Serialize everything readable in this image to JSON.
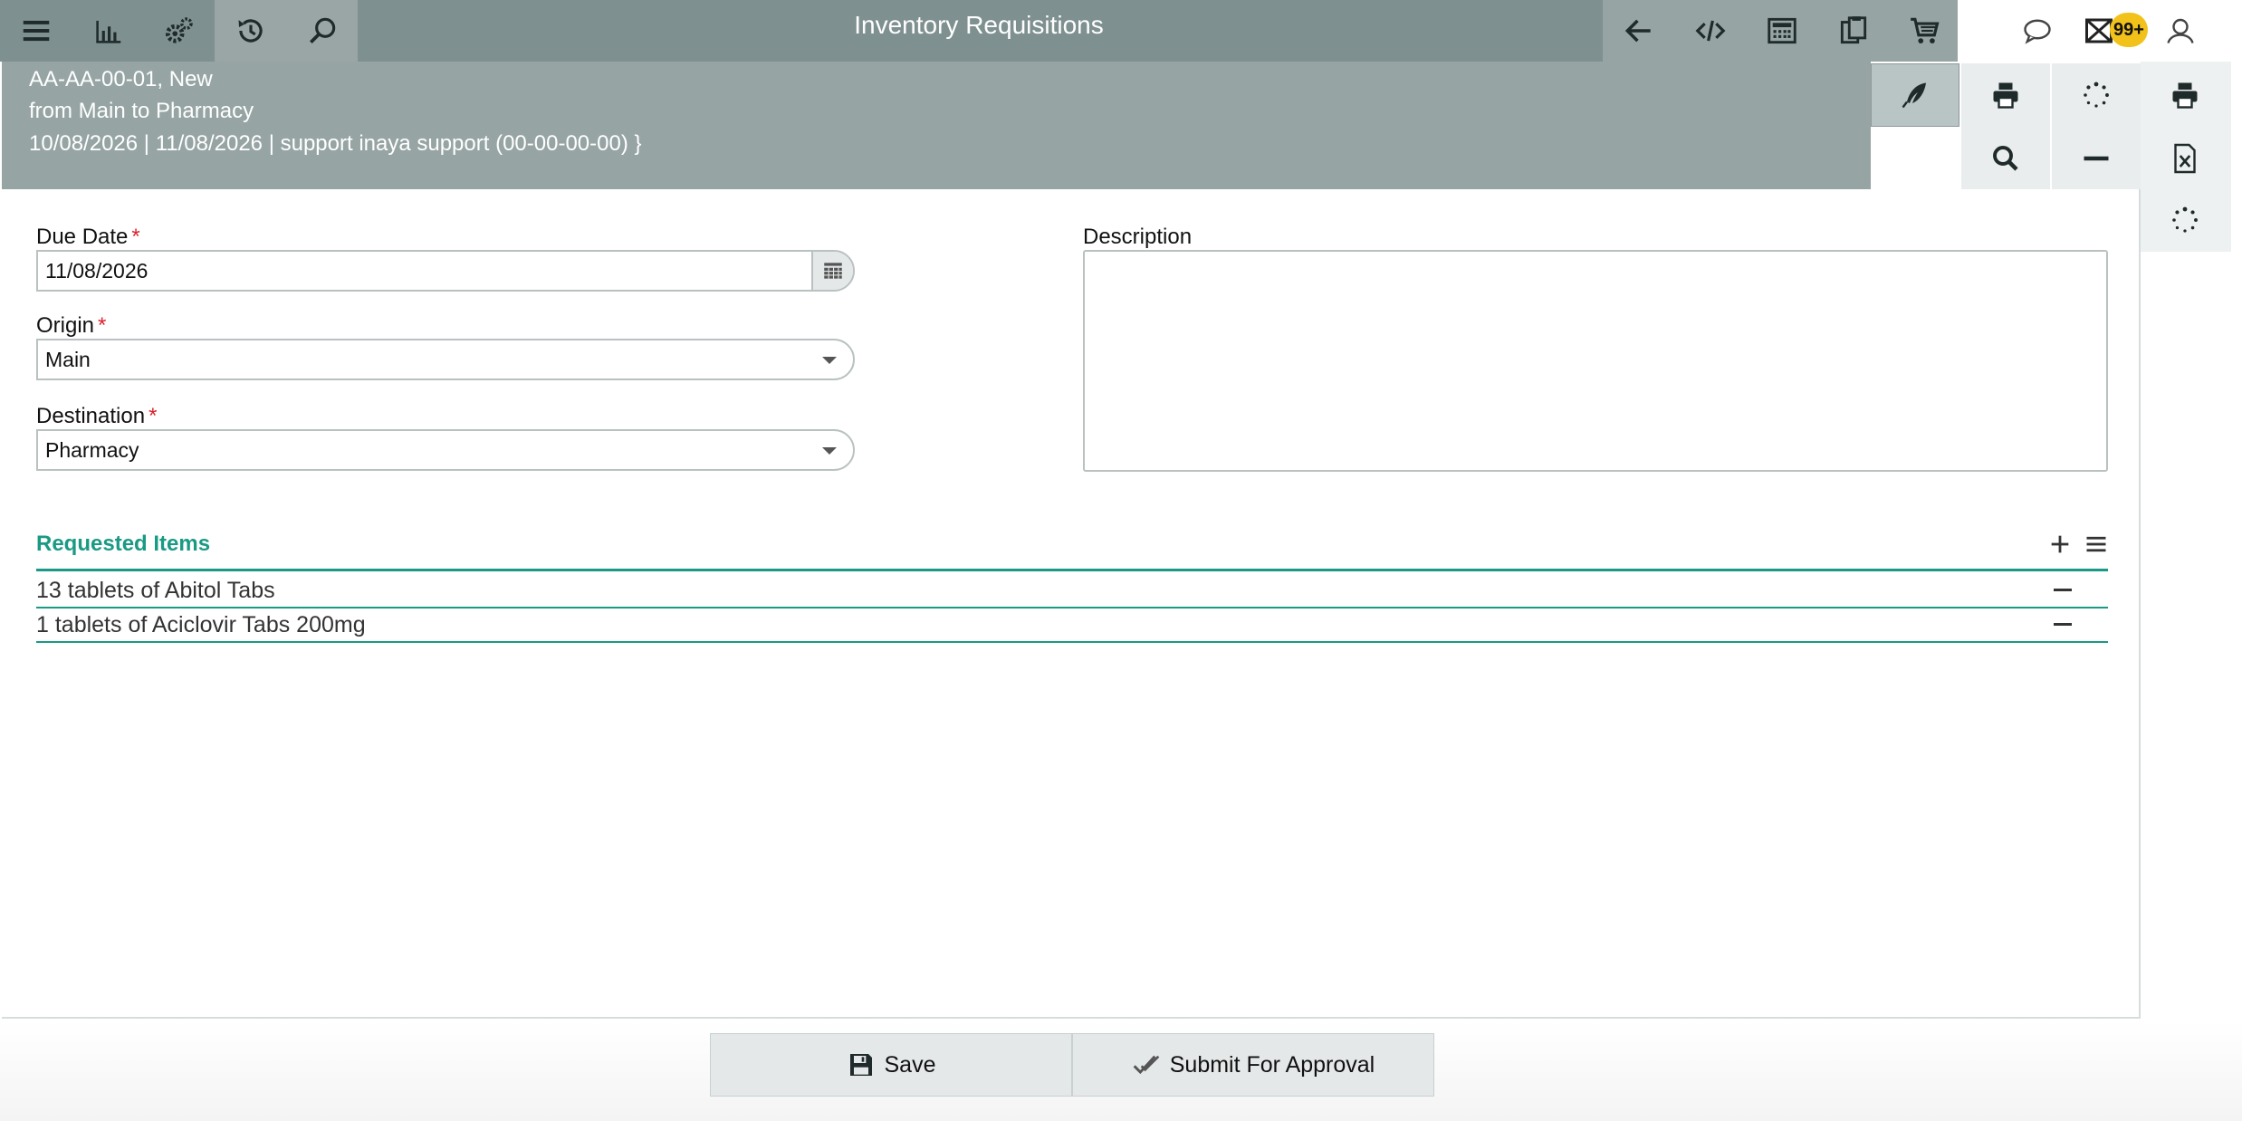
{
  "topbar": {
    "title": "Inventory Requisitions",
    "left_icons": [
      "menu-icon",
      "chart-icon",
      "gears-icon",
      "history-icon",
      "search-icon"
    ],
    "right_icons": [
      "back-arrow-icon",
      "code-icon",
      "calculator-icon",
      "clipboard-icon",
      "cart-icon"
    ],
    "user_icons": [
      "chat-icon",
      "mail-icon",
      "user-icon"
    ],
    "notification_badge": "99+"
  },
  "subheader": {
    "line1": "AA-AA-00-01, New",
    "line2": "from Main to Pharmacy",
    "line3": "10/08/2026 | 11/08/2026 | support inaya support (00-00-00-00) }"
  },
  "actions": {
    "icons": [
      "feather-icon",
      "print-icon",
      "spinner-icon",
      "search-icon",
      "minus-icon"
    ],
    "side_icons": [
      "print-icon",
      "excel-icon",
      "spinner-icon"
    ]
  },
  "form": {
    "due_date": {
      "label": "Due Date",
      "value": "11/08/2026",
      "required": "*"
    },
    "origin": {
      "label": "Origin",
      "value": "Main",
      "required": "*"
    },
    "destination": {
      "label": "Destination",
      "value": "Pharmacy",
      "required": "*"
    },
    "description": {
      "label": "Description",
      "value": ""
    }
  },
  "requested_items": {
    "title": "Requested Items",
    "items": [
      {
        "text": "13 tablets of Abitol Tabs"
      },
      {
        "text": "1 tablets of Aciclovir Tabs 200mg"
      }
    ]
  },
  "buttons": {
    "save": "Save",
    "submit": "Submit For Approval"
  },
  "colors": {
    "topbar": "#7f9090",
    "subheader": "#97a4a4",
    "accent": "#1a9a84",
    "required": "#d9232d",
    "badge": "#f2c21a"
  }
}
